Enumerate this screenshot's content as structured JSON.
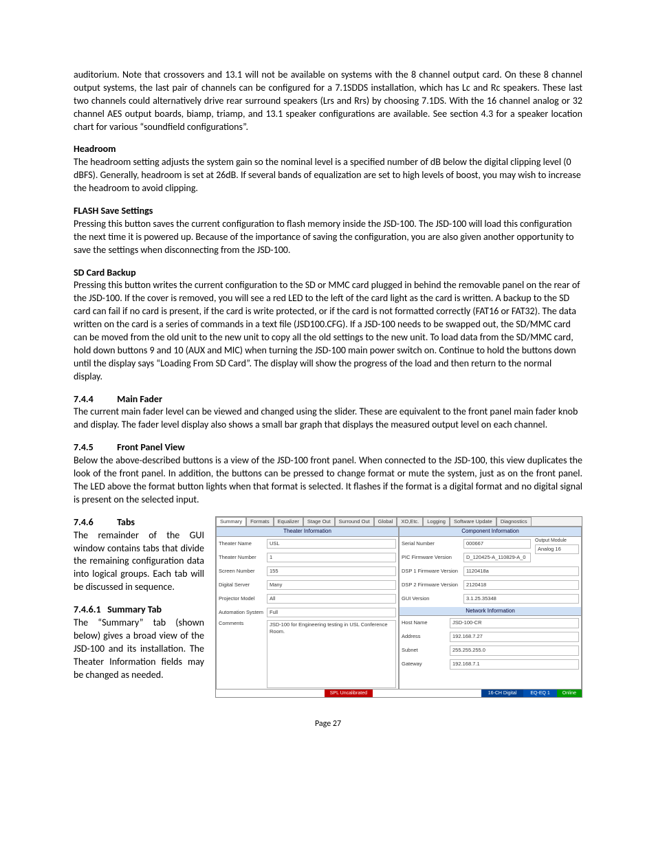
{
  "p1": "auditorium. Note that crossovers and 13.1 will not be available on systems with the 8 channel output card. On these 8 channel output systems, the last pair of channels can be configured for a 7.1SDDS installation, which has Lc and Rc speakers. These last two channels could alternatively drive rear surround speakers (Lrs and Rrs) by choosing 7.1DS. With the 16 channel analog or 32 channel AES output boards, biamp, triamp, and 13.1 speaker configurations are available. See section 4.3 for a speaker location chart for various “soundfield configurations”.",
  "headroom": {
    "title": "Headroom",
    "body": "The headroom setting adjusts the system gain so the nominal level is a specified number of dB below the digital clipping level (0 dBFS).  Generally, headroom is set at 26dB. If several bands of equalization are set to high levels of boost, you may wish to increase the headroom to avoid clipping."
  },
  "flash": {
    "title": "FLASH Save Settings",
    "body": "Pressing this button saves the current configuration to flash memory inside the JSD-100. The JSD-100 will load this configuration the next time it is powered up. Because of the importance of saving the configuration, you are also given another opportunity to save the settings when disconnecting from the JSD-100."
  },
  "sdcard": {
    "title": "SD Card Backup",
    "body": "Pressing this button writes the current configuration to the SD or MMC card plugged in behind the removable panel on the rear of the JSD-100. If the cover is removed, you will see a red LED to the left of the card light as the card is written.  A backup to the SD card can fail if no card is present, if the card is write protected, or if the card is not formatted correctly (FAT16 or FAT32). The data written on the card is a series of commands in a text file (JSD100.CFG). If a JSD-100 needs to be swapped out, the SD/MMC card can be moved from the old unit to the new unit to copy all the old settings to the new unit.  To load data from the SD/MMC card, hold down buttons 9 and 10 (AUX and MIC) when turning the JSD-100 main power switch on. Continue to hold the buttons down until the display says “Loading From SD Card”.  The display will show the progress of the load and then return to the normal display."
  },
  "s744": {
    "num": "7.4.4",
    "title": "Main Fader",
    "body": "The current main fader level can be viewed and changed using the slider.  These are equivalent to the front panel main fader knob and display. The fader level display also shows a small bar graph that displays the measured output level on each channel."
  },
  "s745": {
    "num": "7.4.5",
    "title": "Front Panel View",
    "body": "Below the above-described buttons is a view of the JSD-100 front panel.  When connected to the JSD-100, this view duplicates the look of the front panel.  In addition, the buttons can be pressed to change format or mute the system, just as on the front panel.  The LED above the format button lights when that format is selected. It flashes if the format is a digital format and no digital signal is present on the selected input."
  },
  "s746": {
    "num": "7.4.6",
    "title": "Tabs",
    "body": "The remainder of the GUI window contains tabs that divide the remaining configuration data into logical groups. Each tab will be discussed in sequence."
  },
  "s7461": {
    "num": "7.4.6.1",
    "title": "Summary Tab",
    "body": "The “Summary” tab (shown below) gives a broad view of the JSD-100 and its installation. The Theater Information fields may be changed as needed."
  },
  "ui": {
    "tabs": [
      "Summary",
      "Formats",
      "Equalizer",
      "Stage Out",
      "Surround Out",
      "Global",
      "XO,Etc.",
      "Logging",
      "Software Update",
      "Diagnostics"
    ],
    "theater_header": "Theater Information",
    "component_header": "Component Information",
    "network_header": "Network Information",
    "theater": {
      "name_label": "Theater Name",
      "name": "USL",
      "number_label": "Theater Number",
      "number": "1",
      "screen_label": "Screen Number",
      "screen": "155",
      "server_label": "Digital Server",
      "server": "Many",
      "projector_label": "Projector Model",
      "projector": "All",
      "automation_label": "Automation System",
      "automation": "Full",
      "comments_label": "Comments",
      "comments": "JSD-100 for Engineering testing in USL Conference Room."
    },
    "component": {
      "serial_label": "Serial Number",
      "serial": "000667",
      "output_label": "Output Module",
      "output": "Analog 16",
      "pic_label": "PIC Firmware Version",
      "pic": "D_120425-A_110829-A_0",
      "dsp1_label": "DSP 1 Firmware Version",
      "dsp1": "1120418a",
      "dsp2_label": "DSP 2 Firmware Version",
      "dsp2": "2120418",
      "gui_label": "GUI Version",
      "gui": "3.1.25.35348"
    },
    "network": {
      "host_label": "Host Name",
      "host": "JSD-100-CR",
      "addr_label": "Address",
      "addr": "192.168.7.27",
      "subnet_label": "Subnet",
      "subnet": "255.255.255.0",
      "gateway_label": "Gateway",
      "gateway": "192.168.7.1"
    },
    "status": {
      "spl": "SPL Uncalibrated",
      "mode": "16-CH Digital",
      "eq": "EQ-EQ 1",
      "online": "Online"
    }
  },
  "page_label": "Page 27"
}
